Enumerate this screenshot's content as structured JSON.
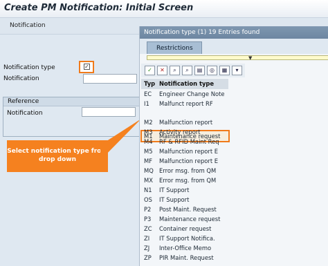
{
  "window": {
    "title": "Create PM Notification: Initial Screen"
  },
  "menu": {
    "item": "Notification"
  },
  "form": {
    "notification_type_label": "Notification type",
    "notification_label": "Notification",
    "reference_group_title": "Reference",
    "reference_notification_label": "Notification"
  },
  "callout": {
    "text": "Select notification type from drop down"
  },
  "popup": {
    "title": "Notification type (1)   19 Entries found",
    "tab": "Restrictions",
    "columns": {
      "code": "Typ",
      "desc": "Notification type"
    },
    "rows": [
      {
        "code": "EC",
        "desc": "Engineer Change Note"
      },
      {
        "code": "I1",
        "desc": "Malfunct report RF"
      },
      {
        "code": "M1",
        "desc": "Maintenance request"
      },
      {
        "code": "M2",
        "desc": "Malfunction report"
      },
      {
        "code": "M3",
        "desc": "Activity report"
      },
      {
        "code": "M4",
        "desc": "RF & RFID Maint Req"
      },
      {
        "code": "M5",
        "desc": "Malfunction report E"
      },
      {
        "code": "MF",
        "desc": "Malfunction report E"
      },
      {
        "code": "MQ",
        "desc": "Error msg. from QM"
      },
      {
        "code": "MX",
        "desc": "Error msg. from QM"
      },
      {
        "code": "N1",
        "desc": "IT Support"
      },
      {
        "code": "OS",
        "desc": "IT Support"
      },
      {
        "code": "P2",
        "desc": "Post Maint. Request"
      },
      {
        "code": "P3",
        "desc": "Maintenance request"
      },
      {
        "code": "ZC",
        "desc": "Container request"
      },
      {
        "code": "ZI",
        "desc": "IT Support Notifica."
      },
      {
        "code": "ZJ",
        "desc": "Inter-Office Memo"
      },
      {
        "code": "ZP",
        "desc": "PIR Maint. Request"
      }
    ],
    "selected_row": "M1"
  },
  "colors": {
    "accent": "#f07a1a",
    "header": "#6d86a1"
  }
}
